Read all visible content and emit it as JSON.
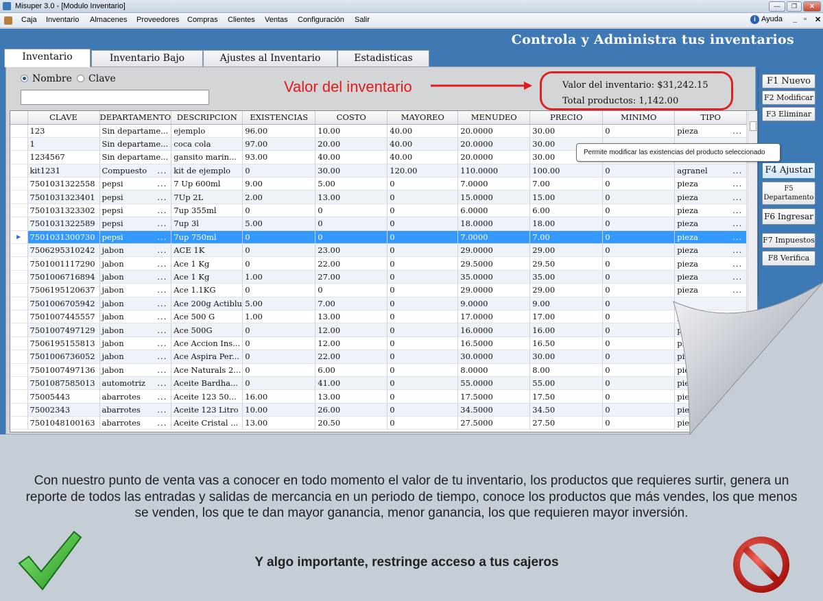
{
  "window": {
    "title": "Misuper 3.0 - [Modulo Inventario]"
  },
  "menu": {
    "items": [
      "Caja",
      "Inventario",
      "Almacenes",
      "Proveedores",
      "Compras",
      "Clientes",
      "Ventas",
      "Configuración",
      "Salir"
    ],
    "help": "Ayuda"
  },
  "headline": "Controla y Administra tus inventarios",
  "tabs": [
    "Inventario",
    "Inventario Bajo",
    "Ajustes al Inventario",
    "Estadisticas"
  ],
  "search": {
    "option_name": "Nombre",
    "option_code": "Clave",
    "value": ""
  },
  "annotation": "Valor del inventario",
  "summary": {
    "inventory_value": "Valor del inventario: $31,242.15",
    "total_products": "Total productos: 1,142.00"
  },
  "table": {
    "columns": [
      "CLAVE",
      "DEPARTAMENTO",
      "DESCRIPCION",
      "EXISTENCIAS",
      "COSTO",
      "MAYOREO",
      "MENUDEO",
      "PRECIO",
      "MINIMO",
      "TIPO"
    ],
    "rows": [
      [
        "123",
        "Sin departame...",
        "ejemplo",
        "96.00",
        "10.00",
        "40.00",
        "20.0000",
        "30.00",
        "0",
        "pieza"
      ],
      [
        "1",
        "Sin departame...",
        "coca cola",
        "97.00",
        "20.00",
        "40.00",
        "20.0000",
        "30.00",
        "",
        ""
      ],
      [
        "1234567",
        "Sin departame...",
        "gansito marin...",
        "93.00",
        "40.00",
        "40.00",
        "20.0000",
        "30.00",
        "",
        ""
      ],
      [
        "kit1231",
        "Compuesto",
        "kit de ejemplo",
        "0",
        "30.00",
        "120.00",
        "110.0000",
        "100.00",
        "0",
        "agranel"
      ],
      [
        "7501031322558",
        "pepsi",
        "7 Up 600ml",
        "9.00",
        "5.00",
        "0",
        "7.0000",
        "7.00",
        "0",
        "pieza"
      ],
      [
        "7501031323401",
        "pepsi",
        "7Up 2L",
        "2.00",
        "13.00",
        "0",
        "15.0000",
        "15.00",
        "0",
        "pieza"
      ],
      [
        "7501031323302",
        "pepsi",
        "7up 355ml",
        "0",
        "0",
        "0",
        "6.0000",
        "6.00",
        "0",
        "pieza"
      ],
      [
        "7501031322589",
        "pepsi",
        "7up 3l",
        "5.00",
        "0",
        "0",
        "18.0000",
        "18.00",
        "0",
        "pieza"
      ],
      [
        "7501031300730",
        "pepsi",
        "7up 750ml",
        "0",
        "0",
        "0",
        "7.0000",
        "7.00",
        "0",
        "pieza"
      ],
      [
        "7506295310242",
        "jabon",
        "ACE  1K",
        "0",
        "23.00",
        "0",
        "29.0000",
        "29.00",
        "0",
        "pieza"
      ],
      [
        "7501001117290",
        "jabon",
        "Ace 1 Kg",
        "0",
        "22.00",
        "0",
        "29.5000",
        "29.50",
        "0",
        "pieza"
      ],
      [
        "7501006716894",
        "jabon",
        "Ace 1 Kg",
        "1.00",
        "27.00",
        "0",
        "35.0000",
        "35.00",
        "0",
        "pieza"
      ],
      [
        "7506195120637",
        "jabon",
        "Ace 1.1KG",
        "0",
        "0",
        "0",
        "29.0000",
        "29.00",
        "0",
        "pieza"
      ],
      [
        "7501006705942",
        "jabon",
        "Ace 200g Actiblu",
        "5.00",
        "7.00",
        "0",
        "9.0000",
        "9.00",
        "0",
        ""
      ],
      [
        "7501007445557",
        "jabon",
        "Ace 500 G",
        "1.00",
        "13.00",
        "0",
        "17.0000",
        "17.00",
        "0",
        "p"
      ],
      [
        "7501007497129",
        "jabon",
        "Ace 500G",
        "0",
        "12.00",
        "0",
        "16.0000",
        "16.00",
        "0",
        "pi"
      ],
      [
        "7506195155813",
        "jabon",
        "Ace Accion Ins...",
        "0",
        "12.00",
        "0",
        "16.5000",
        "16.50",
        "0",
        "pie"
      ],
      [
        "7501006736052",
        "jabon",
        "Ace Aspira Per...",
        "0",
        "22.00",
        "0",
        "30.0000",
        "30.00",
        "0",
        "piez"
      ],
      [
        "7501007497136",
        "jabon",
        "Ace Naturals 2...",
        "0",
        "6.00",
        "0",
        "8.0000",
        "8.00",
        "0",
        "piez"
      ],
      [
        "7501087585013",
        "automotriz",
        "Aceite Bardha...",
        "0",
        "41.00",
        "0",
        "55.0000",
        "55.00",
        "0",
        "piez"
      ],
      [
        "75005443",
        "abarrotes",
        "Aceite 123 50...",
        "16.00",
        "13.00",
        "0",
        "17.5000",
        "17.50",
        "0",
        "pieza"
      ],
      [
        "75002343",
        "abarrotes",
        "Aceite 123 Litro",
        "10.00",
        "26.00",
        "0",
        "34.5000",
        "34.50",
        "0",
        "pieza"
      ],
      [
        "7501048100163",
        "abarrotes",
        "Aceite Cristal ...",
        "13.00",
        "20.50",
        "0",
        "27.5000",
        "27.50",
        "0",
        "pie"
      ]
    ],
    "selected_row": 8
  },
  "actions": {
    "nuevo": "F1 Nuevo",
    "modificar": "F2 Modificar",
    "eliminar": "F3 Eliminar",
    "ajustar": "F4 Ajustar",
    "departamento_key": "F5",
    "departamento_label": "Departamento",
    "ingresar": "F6 Ingresar",
    "impuestos": "F7 Impuestos",
    "verifica": "F8 Verifica"
  },
  "tooltip": "Permite modificar las existencias del producto seleccionado",
  "message": "Con nuestro punto de venta vas a conocer en todo momento el valor de tu inventario, los productos que requieres surtir, genera un reporte de todos las entradas y salidas de mercancia en un periodo de tiempo, conoce los productos que más vendes, los que menos se venden, los que te dan mayor ganancia, menor ganancia, los que requieren mayor inversión.",
  "strong_message": "Y algo importante, restringe acceso a tus cajeros",
  "colors": {
    "accent": "#3f79b3",
    "selection": "#3399ff",
    "annotation": "#e01b1b"
  }
}
